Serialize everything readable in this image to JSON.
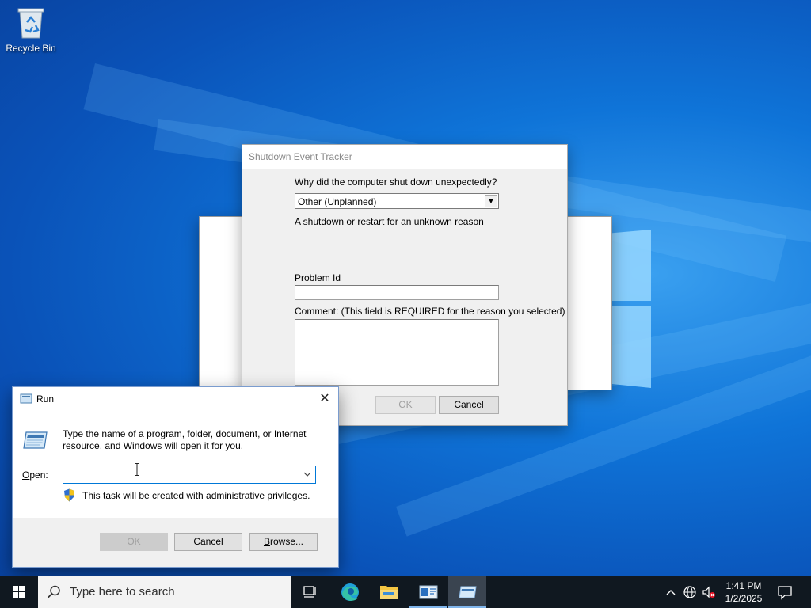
{
  "desktop": {
    "icons": [
      {
        "label": "Recycle Bin",
        "icon": "recycle-bin-icon"
      }
    ]
  },
  "shutdown_tracker": {
    "title": "Shutdown Event Tracker",
    "question": "Why did the computer shut down unexpectedly?",
    "reason_selected": "Other (Unplanned)",
    "reason_description": "A shutdown or restart for an unknown reason",
    "problem_id_label": "Problem Id",
    "problem_id_value": "",
    "comment_label": "Comment: (This field is REQUIRED for the reason you selected)",
    "comment_value": "",
    "ok_label": "OK",
    "cancel_label": "Cancel"
  },
  "run_dialog": {
    "title": "Run",
    "instructions": "Type the name of a program, folder, document, or Internet resource, and Windows will open it for you.",
    "open_label_underlined": "O",
    "open_label_rest": "pen:",
    "open_value": "",
    "admin_note": "This task will be created with administrative privileges.",
    "ok_label": "OK",
    "cancel_label": "Cancel",
    "browse_label_underlined": "B",
    "browse_label_rest": "rowse..."
  },
  "taskbar": {
    "search_placeholder": "Type here to search",
    "apps": [
      {
        "name": "task-view-icon"
      },
      {
        "name": "edge-icon"
      },
      {
        "name": "file-explorer-icon"
      },
      {
        "name": "server-manager-icon"
      },
      {
        "name": "run-icon"
      }
    ],
    "tray_icons": [
      "chevron-up-icon",
      "network-icon",
      "volume-muted-icon"
    ],
    "time": "1:41 PM",
    "date": "1/2/2025"
  },
  "colors": {
    "desktop_blue": "#0f74d8",
    "accent": "#0078d7",
    "taskbar": "#101820"
  }
}
